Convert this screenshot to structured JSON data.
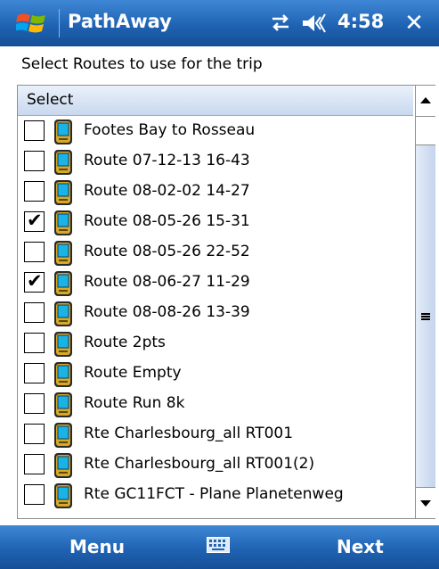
{
  "titlebar": {
    "app_name": "PathAway",
    "time": "4:58",
    "close_label": "✕"
  },
  "prompt": "Select Routes to use for the trip",
  "list": {
    "header": "Select",
    "items": [
      {
        "label": "Footes Bay to Rosseau",
        "checked": false
      },
      {
        "label": "Route 07-12-13 16-43",
        "checked": false
      },
      {
        "label": "Route 08-02-02 14-27",
        "checked": false
      },
      {
        "label": "Route 08-05-26 15-31",
        "checked": true
      },
      {
        "label": "Route 08-05-26 22-52",
        "checked": false
      },
      {
        "label": "Route 08-06-27 11-29",
        "checked": true
      },
      {
        "label": "Route 08-08-26 13-39",
        "checked": false
      },
      {
        "label": "Route 2pts",
        "checked": false
      },
      {
        "label": "Route Empty",
        "checked": false
      },
      {
        "label": "Route Run 8k",
        "checked": false
      },
      {
        "label": "Rte Charlesbourg_all RT001",
        "checked": false
      },
      {
        "label": "Rte Charlesbourg_all RT001(2)",
        "checked": false
      },
      {
        "label": "Rte GC11FCT - Plane Planetenweg",
        "checked": false
      }
    ]
  },
  "softkeys": {
    "left": "Menu",
    "right": "Next"
  },
  "colors": {
    "bar_blue": "#1f63b3",
    "header_blue": "#c9d8ee",
    "device_icon": "#1ab3e6"
  }
}
